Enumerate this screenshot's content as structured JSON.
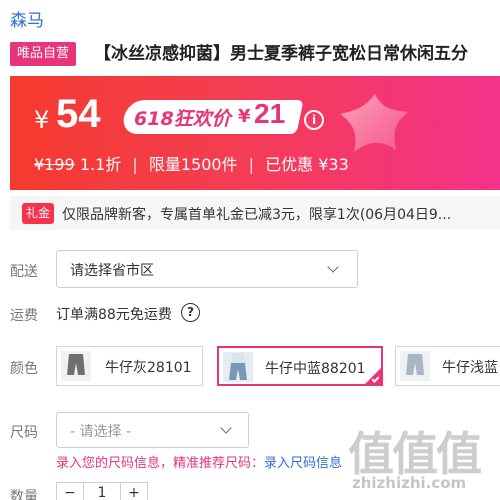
{
  "header": {
    "brand": "森马",
    "self_badge": "唯品自营",
    "product_title": "【冰丝凉感抑菌】男士夏季裤子宽松日常休闲五分"
  },
  "price_banner": {
    "currency": "¥",
    "price": "54",
    "promo_label": "618狂欢价",
    "promo_currency": "¥",
    "promo_price": "21",
    "info_icon": "i",
    "original_price": "¥199",
    "discount": "1.1折",
    "limit": "限量1500件",
    "saved": "已优惠 ¥33",
    "colors": {
      "start": "#f53a2e",
      "end": "#f3328a",
      "promo_text": "#e8357a"
    }
  },
  "coupon": {
    "badge": "礼金",
    "text": "仅限品牌新客，专属首单礼金已减3元，限享1次(06月04日9..."
  },
  "delivery": {
    "label": "配送",
    "placeholder": "请选择省市区"
  },
  "shipping": {
    "label": "运费",
    "text": "订单满88元免运费",
    "help_icon": "?"
  },
  "color": {
    "label": "颜色",
    "options": [
      {
        "label": "牛仔灰28101",
        "selected": false,
        "thumb_color": "#6f6f72"
      },
      {
        "label": "牛仔中蓝88201",
        "selected": true,
        "thumb_color": "#7b97b8"
      },
      {
        "label": "牛仔浅蓝",
        "selected": false,
        "thumb_color": "#a9b6c6"
      }
    ]
  },
  "size": {
    "label": "尺码",
    "placeholder": "- 请选择 -",
    "hint": "录入您的尺码信息，精准推荐尺码：",
    "hint_link": "录入尺码信息"
  },
  "quantity": {
    "label": "数量",
    "minus": "−",
    "value": "1",
    "plus": "+"
  },
  "watermark": {
    "text": "值值值",
    "url": "zhizhizhi.com"
  },
  "accent_color": "#e8357a"
}
